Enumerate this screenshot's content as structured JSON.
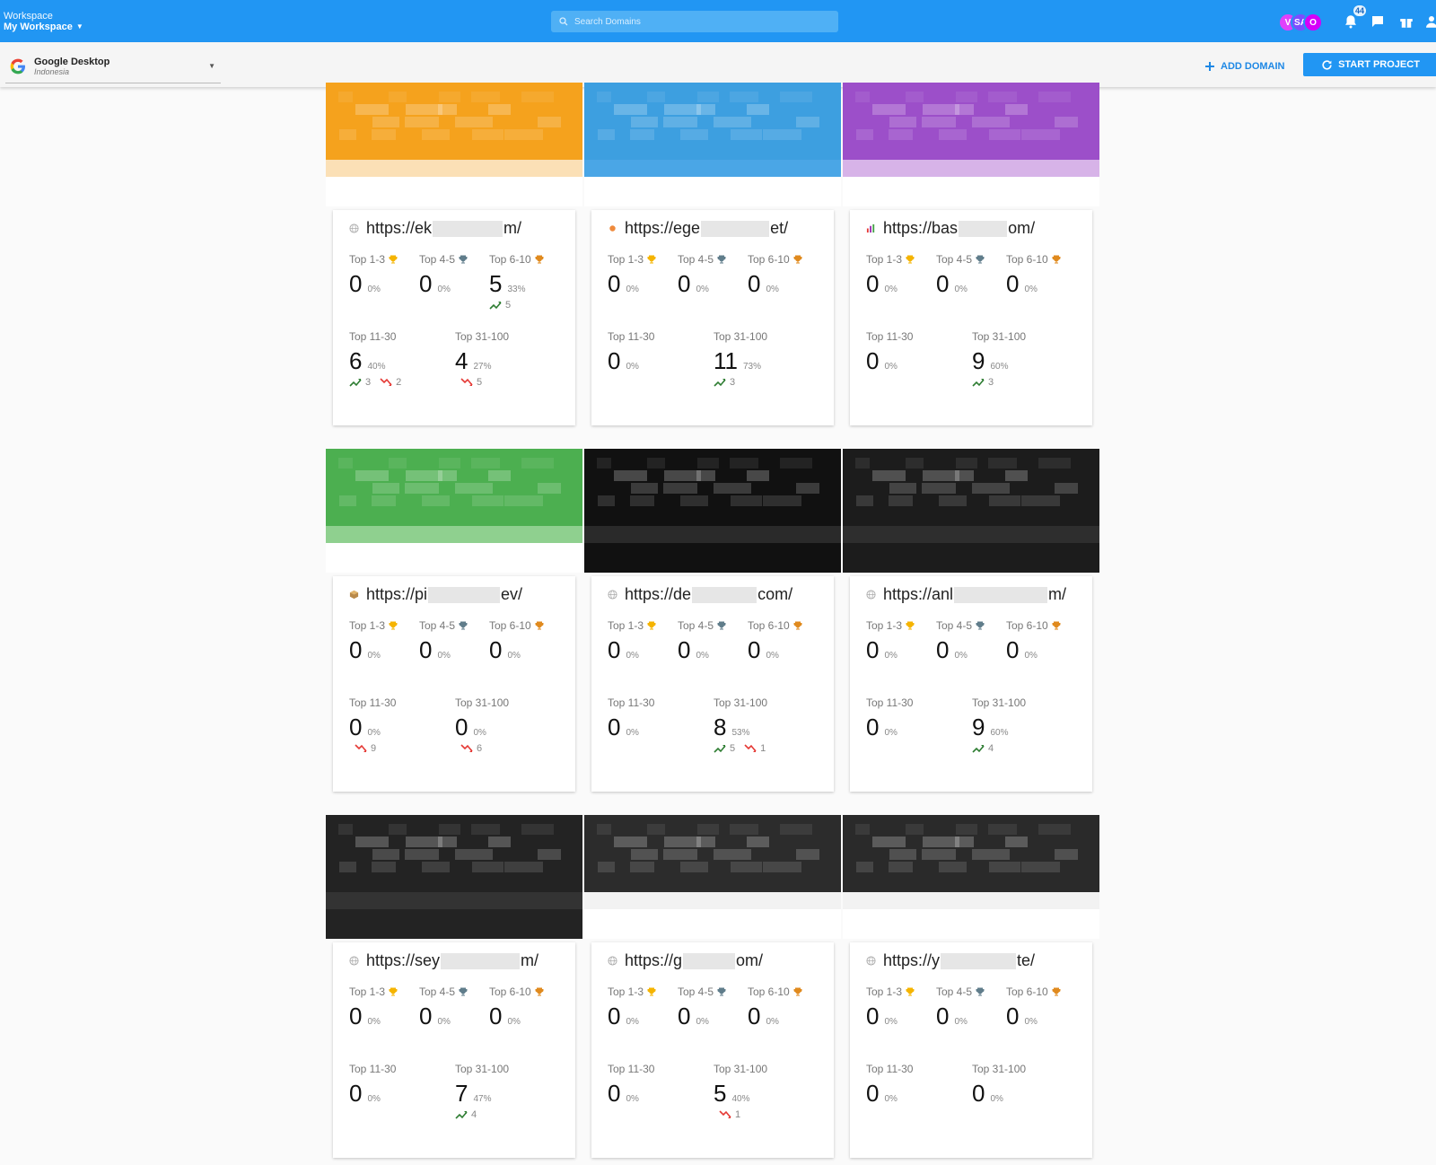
{
  "header": {
    "workspace_label": "Workspace",
    "workspace_name": "My Workspace",
    "search_placeholder": "Search Domains",
    "avatars": [
      {
        "initials": "V",
        "color": "#e040fb"
      },
      {
        "initials": "SA",
        "color": "#7c4dff"
      },
      {
        "initials": "O",
        "color": "#d500f9"
      }
    ],
    "notification_count": "44"
  },
  "subbar": {
    "engine_name": "Google Desktop",
    "engine_location": "Indonesia",
    "add_domain_label": "ADD DOMAIN",
    "start_project_label": "START PROJECT"
  },
  "labels": {
    "top1": "Top 1-3",
    "top4": "Top 4-5",
    "top6": "Top 6-10",
    "top11": "Top 11-30",
    "top31": "Top 31-100"
  },
  "colors": {
    "primary": "#2196f3",
    "gold": "#f5b400",
    "silver": "#607d8b",
    "bronze": "#e08a1e",
    "up": "#2e7d32",
    "down": "#e53935"
  },
  "cards": [
    {
      "url_start": "https://ek",
      "url_end": "m/",
      "favicon": "globe-icon",
      "top1": {
        "num": "0",
        "pct": "0%"
      },
      "top4": {
        "num": "0",
        "pct": "0%"
      },
      "top6": {
        "num": "5",
        "pct": "33%",
        "up": "5",
        "down": ""
      },
      "top11": {
        "num": "6",
        "pct": "40%",
        "up": "3",
        "down": "2"
      },
      "top31": {
        "num": "4",
        "pct": "27%",
        "up": "",
        "down": "5"
      },
      "thumb": {
        "top": "#f5a21d",
        "mid": "#fbe0b6",
        "bottom": "#ffffff"
      }
    },
    {
      "url_start": "https://ege",
      "url_end": "et/",
      "favicon": "dot-icon",
      "top1": {
        "num": "0",
        "pct": "0%"
      },
      "top4": {
        "num": "0",
        "pct": "0%"
      },
      "top6": {
        "num": "0",
        "pct": "0%",
        "up": "",
        "down": ""
      },
      "top11": {
        "num": "0",
        "pct": "0%",
        "up": "",
        "down": ""
      },
      "top31": {
        "num": "11",
        "pct": "73%",
        "up": "3",
        "down": ""
      },
      "thumb": {
        "top": "#3d9fe0",
        "mid": "#4aa6e6",
        "bottom": "#ffffff"
      }
    },
    {
      "url_start": "https://bas",
      "url_end": "om/",
      "favicon": "bar-chart-icon",
      "top1": {
        "num": "0",
        "pct": "0%"
      },
      "top4": {
        "num": "0",
        "pct": "0%"
      },
      "top6": {
        "num": "0",
        "pct": "0%",
        "up": "",
        "down": ""
      },
      "top11": {
        "num": "0",
        "pct": "0%",
        "up": "",
        "down": ""
      },
      "top31": {
        "num": "9",
        "pct": "60%",
        "up": "3",
        "down": ""
      },
      "thumb": {
        "top": "#9c4fc9",
        "mid": "#d7b3e8",
        "bottom": "#ffffff"
      }
    },
    {
      "url_start": "https://pi",
      "url_end": "ev/",
      "favicon": "cube-icon",
      "top1": {
        "num": "0",
        "pct": "0%"
      },
      "top4": {
        "num": "0",
        "pct": "0%"
      },
      "top6": {
        "num": "0",
        "pct": "0%",
        "up": "",
        "down": ""
      },
      "top11": {
        "num": "0",
        "pct": "0%",
        "up": "",
        "down": "9"
      },
      "top31": {
        "num": "0",
        "pct": "0%",
        "up": "",
        "down": "6"
      },
      "thumb": {
        "top": "#4caf50",
        "mid": "#8fd08f",
        "bottom": "#ffffff"
      }
    },
    {
      "url_start": "https://de",
      "url_end": "com/",
      "favicon": "globe-icon",
      "top1": {
        "num": "0",
        "pct": "0%"
      },
      "top4": {
        "num": "0",
        "pct": "0%"
      },
      "top6": {
        "num": "0",
        "pct": "0%",
        "up": "",
        "down": ""
      },
      "top11": {
        "num": "0",
        "pct": "0%",
        "up": "",
        "down": ""
      },
      "top31": {
        "num": "8",
        "pct": "53%",
        "up": "5",
        "down": "1"
      },
      "thumb": {
        "top": "#111111",
        "mid": "#2a2a2a",
        "bottom": "#111111"
      }
    },
    {
      "url_start": "https://anl",
      "url_end": "m/",
      "favicon": "globe-icon",
      "top1": {
        "num": "0",
        "pct": "0%"
      },
      "top4": {
        "num": "0",
        "pct": "0%"
      },
      "top6": {
        "num": "0",
        "pct": "0%",
        "up": "",
        "down": ""
      },
      "top11": {
        "num": "0",
        "pct": "0%",
        "up": "",
        "down": ""
      },
      "top31": {
        "num": "9",
        "pct": "60%",
        "up": "4",
        "down": ""
      },
      "thumb": {
        "top": "#1c1c1c",
        "mid": "#2e2e2e",
        "bottom": "#1c1c1c"
      }
    },
    {
      "url_start": "https://sey",
      "url_end": "m/",
      "favicon": "globe-icon",
      "top1": {
        "num": "0",
        "pct": "0%"
      },
      "top4": {
        "num": "0",
        "pct": "0%"
      },
      "top6": {
        "num": "0",
        "pct": "0%",
        "up": "",
        "down": ""
      },
      "top11": {
        "num": "0",
        "pct": "0%",
        "up": "",
        "down": ""
      },
      "top31": {
        "num": "7",
        "pct": "47%",
        "up": "4",
        "down": ""
      },
      "thumb": {
        "top": "#232323",
        "mid": "#333333",
        "bottom": "#232323"
      }
    },
    {
      "url_start": "https://g",
      "url_end": "om/",
      "favicon": "globe-icon",
      "top1": {
        "num": "0",
        "pct": "0%"
      },
      "top4": {
        "num": "0",
        "pct": "0%"
      },
      "top6": {
        "num": "0",
        "pct": "0%",
        "up": "",
        "down": ""
      },
      "top11": {
        "num": "0",
        "pct": "0%",
        "up": "",
        "down": ""
      },
      "top31": {
        "num": "5",
        "pct": "40%",
        "up": "",
        "down": "1"
      },
      "thumb": {
        "top": "#2c2c2c",
        "mid": "#f2f2f2",
        "bottom": "#ffffff"
      }
    },
    {
      "url_start": "https://y",
      "url_end": "te/",
      "favicon": "globe-icon",
      "top1": {
        "num": "0",
        "pct": "0%"
      },
      "top4": {
        "num": "0",
        "pct": "0%"
      },
      "top6": {
        "num": "0",
        "pct": "0%",
        "up": "",
        "down": ""
      },
      "top11": {
        "num": "0",
        "pct": "0%",
        "up": "",
        "down": ""
      },
      "top31": {
        "num": "0",
        "pct": "0%",
        "up": "",
        "down": ""
      },
      "thumb": {
        "top": "#2a2a2a",
        "mid": "#f2f2f2",
        "bottom": "#ffffff"
      }
    }
  ]
}
